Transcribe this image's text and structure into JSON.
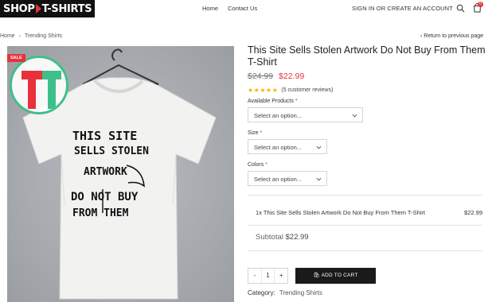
{
  "header": {
    "logo_left": "SHOP",
    "logo_right": "T-SHIRTS",
    "nav": [
      "Home",
      "Contact Us"
    ],
    "account": "SIGN IN OR CREATE AN ACCOUNT",
    "cart_count": "0"
  },
  "breadcrumb": {
    "items": [
      "Home",
      "Trending Shirts"
    ],
    "back": "Return to previous page"
  },
  "product": {
    "sale_badge": "SALE",
    "title": "This Site Sells Stolen Artwork Do Not Buy From Them T-Shirt",
    "price_old": "$24.99",
    "price_new": "$22.99",
    "stars": 5,
    "reviews": "(5 customer reviews)",
    "shirt_text": [
      "THIS SITE",
      "SELLS STOLEN",
      "ARTWORK",
      "DO NOT BUY",
      "FROM THEM"
    ]
  },
  "options": {
    "products_label": "Available Products",
    "products_value": "Select an option...",
    "size_label": "Size",
    "size_value": "Select an option...",
    "colors_label": "Colors",
    "colors_value": "Select an option...",
    "required": "*"
  },
  "summary": {
    "line": "1x This Site Sells Stolen Artwork Do Not Buy From Them T-Shirt",
    "line_price": "$22.99",
    "subtotal_label": "Subtotal",
    "subtotal_value": "$22.99"
  },
  "cart": {
    "minus": "-",
    "qty": "1",
    "plus": "+",
    "add_label": "ADD TO CART"
  },
  "meta": {
    "category_label": "Category:",
    "category_value": "Trending Shirts"
  },
  "colors": {
    "accent": "#e8313a",
    "brand_green": "#3fbf8a",
    "button": "#1a1a1a"
  }
}
